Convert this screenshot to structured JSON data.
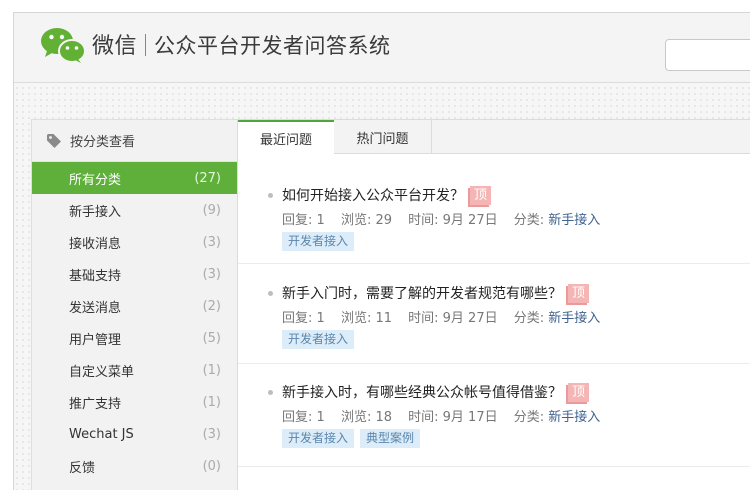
{
  "header": {
    "brand": "微信",
    "subtitle": "公众平台开发者问答系统",
    "search": {
      "value": "",
      "placeholder": ""
    }
  },
  "sidebar": {
    "heading": "按分类查看",
    "items": [
      {
        "label": "所有分类",
        "count": "(27)",
        "active": true
      },
      {
        "label": "新手接入",
        "count": "(9)"
      },
      {
        "label": "接收消息",
        "count": "(3)"
      },
      {
        "label": "基础支持",
        "count": "(3)"
      },
      {
        "label": "发送消息",
        "count": "(2)"
      },
      {
        "label": "用户管理",
        "count": "(5)"
      },
      {
        "label": "自定义菜单",
        "count": "(1)"
      },
      {
        "label": "推广支持",
        "count": "(1)"
      },
      {
        "label": "Wechat JS",
        "count": "(3)"
      },
      {
        "label": "反馈",
        "count": "(0)"
      }
    ]
  },
  "tabs": [
    {
      "label": "最近问题",
      "active": true
    },
    {
      "label": "热门问题"
    }
  ],
  "questions": [
    {
      "title": "如何开始接入公众平台开发？",
      "top_badge": "顶",
      "replies": "回复: 1",
      "views": "浏览: 29",
      "time": "时间: 9月 27日",
      "category_label": "分类:",
      "category": "新手接入",
      "tags": [
        "开发者接入"
      ]
    },
    {
      "title": "新手入门时，需要了解的开发者规范有哪些？",
      "top_badge": "顶",
      "replies": "回复: 1",
      "views": "浏览: 11",
      "time": "时间: 9月 27日",
      "category_label": "分类:",
      "category": "新手接入",
      "tags": [
        "开发者接入"
      ]
    },
    {
      "title": "新手接入时，有哪些经典公众帐号值得借鉴？",
      "top_badge": "顶",
      "replies": "回复: 1",
      "views": "浏览: 18",
      "time": "时间: 9月 17日",
      "category_label": "分类:",
      "category": "新手接入",
      "tags": [
        "开发者接入",
        "典型案例"
      ]
    }
  ],
  "colors": {
    "accent_green": "#5fb03b",
    "tab_border": "#4fa63a",
    "top_badge": "#f5b5b5",
    "tag_bg": "#dcecf8",
    "link": "#40638f"
  }
}
